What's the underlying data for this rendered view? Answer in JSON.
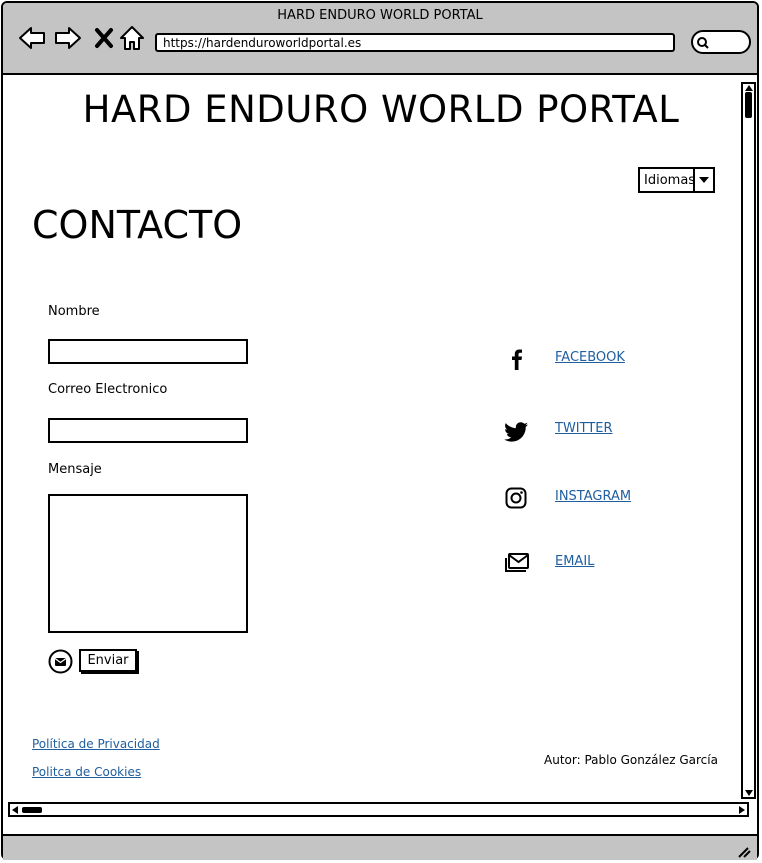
{
  "browser": {
    "window_title": "HARD ENDURO WORLD PORTAL",
    "url": "https://hardenduroworldportal.es",
    "icons": [
      "back-arrow-icon",
      "forward-arrow-icon",
      "close-x-icon",
      "home-icon",
      "search-icon"
    ]
  },
  "site": {
    "title": "HARD ENDURO WORLD PORTAL",
    "language_select": "Idiomas"
  },
  "page": {
    "heading": "CONTACTO"
  },
  "form": {
    "name_label": "Nombre",
    "email_label": "Correo Electronico",
    "message_label": "Mensaje",
    "name_value": "",
    "email_value": "",
    "message_value": "",
    "submit_label": "Enviar"
  },
  "social": [
    {
      "label": "FACEBOOK",
      "icon": "facebook-icon"
    },
    {
      "label": "TWITTER",
      "icon": "twitter-icon"
    },
    {
      "label": "INSTAGRAM",
      "icon": "instagram-icon"
    },
    {
      "label": "EMAIL",
      "icon": "mail-icon"
    }
  ],
  "footer": {
    "privacy_link": "Política de Privacidad",
    "cookies_link": "Politca de Cookies",
    "author": "Autor: Pablo González García"
  },
  "colors": {
    "chrome": "#c4c4c4",
    "link": "#1f5fa0"
  }
}
